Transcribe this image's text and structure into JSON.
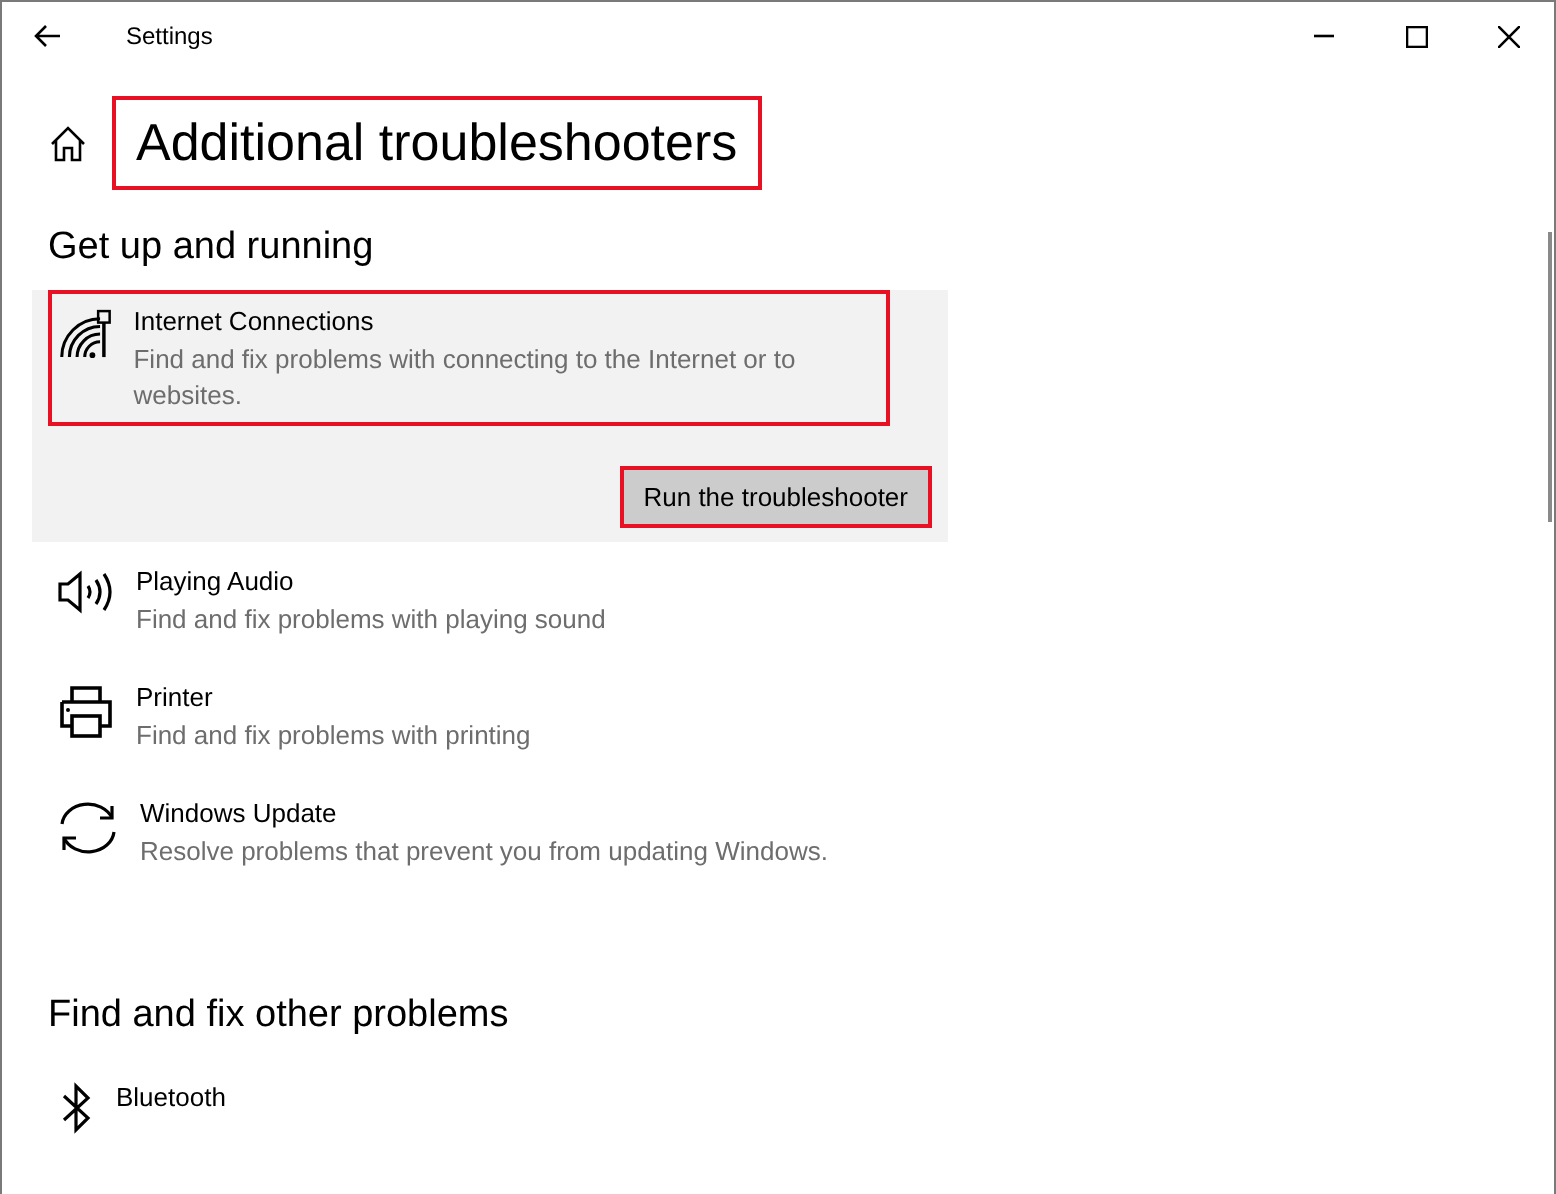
{
  "window": {
    "title": "Settings"
  },
  "page": {
    "title": "Additional troubleshooters",
    "highlighted": true
  },
  "sections": [
    {
      "title": "Get up and running",
      "items": [
        {
          "kind": "internet",
          "name": "Internet Connections",
          "description": "Find and fix problems with connecting to the Internet or to websites.",
          "expanded": true,
          "highlighted": true,
          "button": {
            "label": "Run the troubleshooter",
            "highlighted": true
          }
        },
        {
          "kind": "audio",
          "name": "Playing Audio",
          "description": "Find and fix problems with playing sound",
          "expanded": false,
          "highlighted": false
        },
        {
          "kind": "printer",
          "name": "Printer",
          "description": "Find and fix problems with printing",
          "expanded": false,
          "highlighted": false
        },
        {
          "kind": "update",
          "name": "Windows Update",
          "description": "Resolve problems that prevent you from updating Windows.",
          "expanded": false,
          "highlighted": false
        }
      ]
    },
    {
      "title": "Find and fix other problems",
      "items": [
        {
          "kind": "bluetooth",
          "name": "Bluetooth",
          "expanded": false,
          "highlighted": false
        }
      ]
    }
  ]
}
